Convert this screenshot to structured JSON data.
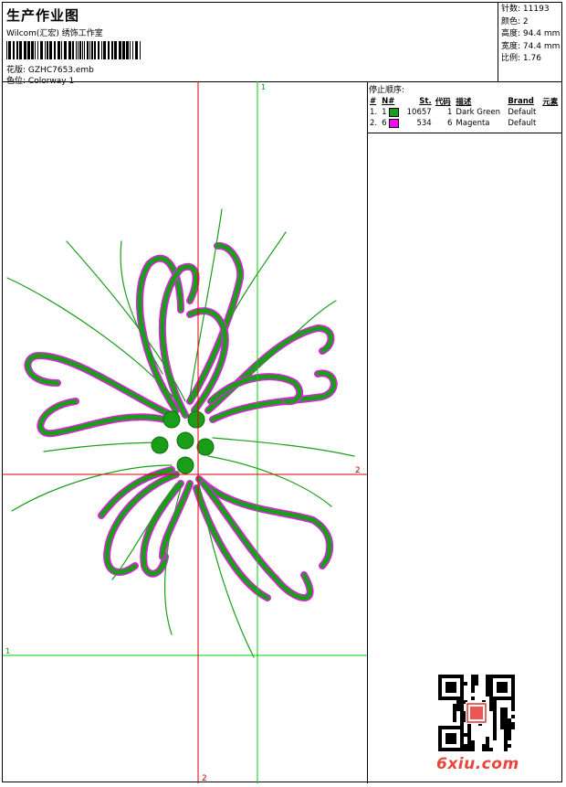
{
  "header": {
    "title": "生产作业图",
    "company": "Wilcom(汇宏) 绣饰工作室",
    "design_label": "花版:",
    "design_value": "GZHC7653.emb",
    "colorway_label": "色位:",
    "colorway_value": "Colorway 1"
  },
  "stats": [
    {
      "label": "针数:",
      "value": "11193"
    },
    {
      "label": "颜色:",
      "value": "2"
    },
    {
      "label": "高度:",
      "value": "94.4 mm"
    },
    {
      "label": "宽度:",
      "value": "74.4 mm"
    },
    {
      "label": "比例:",
      "value": "1.76"
    }
  ],
  "panel": {
    "title": "停止顺序:",
    "columns": [
      "#",
      "N#",
      "St.",
      "代码",
      "描述",
      "Brand",
      "元素"
    ],
    "rows": [
      {
        "idx": "1.",
        "n": "1",
        "color": "#1a9e1a",
        "st": "10657",
        "code": "1",
        "desc": "Dark Green",
        "brand": "Default"
      },
      {
        "idx": "2.",
        "n": "6",
        "color": "#ff00ff",
        "st": "534",
        "code": "6",
        "desc": "Magenta",
        "brand": "Default"
      }
    ]
  },
  "axes": {
    "green_v": "1",
    "green_h": "1",
    "red_h": "2",
    "red_v": "2"
  },
  "watermark": "6xiu.com",
  "colors": {
    "stitch_green": "#1a9e1a",
    "stitch_magenta": "#e020e0",
    "guide_red": "#e00000",
    "guide_green": "#00d000"
  }
}
